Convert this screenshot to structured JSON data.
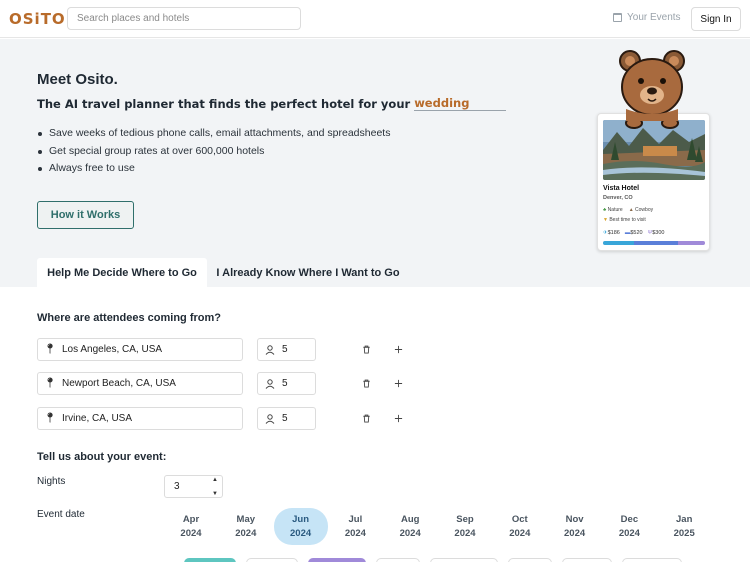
{
  "nav": {
    "logo": "OSiTO",
    "search_placeholder": "Search places and hotels",
    "your_events": "Your Events",
    "sign_in": "Sign In"
  },
  "hero": {
    "title": "Meet Osito.",
    "subtitle": "The AI travel planner that finds the perfect hotel for your",
    "rotating_word": "wedding",
    "bullets": [
      "Save weeks of tedious phone calls, email attachments, and spreadsheets",
      "Get special group rates at over 600,000 hotels",
      "Always free to use"
    ],
    "cta": "How it Works"
  },
  "hotel_card": {
    "name": "Vista Hotel",
    "location": "Denver, CO",
    "tags": [
      "Nature",
      "Cowboy"
    ],
    "best_time": "Best time to visit",
    "prices": [
      "$186",
      "$520",
      "$300"
    ],
    "price_bar_fractions": [
      0.3,
      0.44,
      0.26
    ]
  },
  "tabs": [
    {
      "label": "Help Me Decide Where to Go",
      "active": true
    },
    {
      "label": "I Already Know Where I Want to Go",
      "active": false
    }
  ],
  "attendees": {
    "title": "Where are attendees coming from?",
    "rows": [
      {
        "location": "Los Angeles, CA, USA",
        "count": "5"
      },
      {
        "location": "Newport Beach, CA, USA",
        "count": "5"
      },
      {
        "location": "Irvine, CA, USA",
        "count": "5"
      }
    ]
  },
  "event": {
    "title": "Tell us about your event:",
    "nights_label": "Nights",
    "nights_value": "3",
    "date_label": "Event date",
    "months": [
      {
        "month": "Apr",
        "year": "2024",
        "selected": false
      },
      {
        "month": "May",
        "year": "2024",
        "selected": false
      },
      {
        "month": "Jun",
        "year": "2024",
        "selected": true
      },
      {
        "month": "Jul",
        "year": "2024",
        "selected": false
      },
      {
        "month": "Aug",
        "year": "2024",
        "selected": false
      },
      {
        "month": "Sep",
        "year": "2024",
        "selected": false
      },
      {
        "month": "Oct",
        "year": "2024",
        "selected": false
      },
      {
        "month": "Nov",
        "year": "2024",
        "selected": false
      },
      {
        "month": "Dec",
        "year": "2024",
        "selected": false
      },
      {
        "month": "Jan",
        "year": "2025",
        "selected": false
      }
    ]
  },
  "colors": {
    "brand": "#b86b2a",
    "accent": "#2f6f6b",
    "selected_month": "#c6e4f6"
  }
}
